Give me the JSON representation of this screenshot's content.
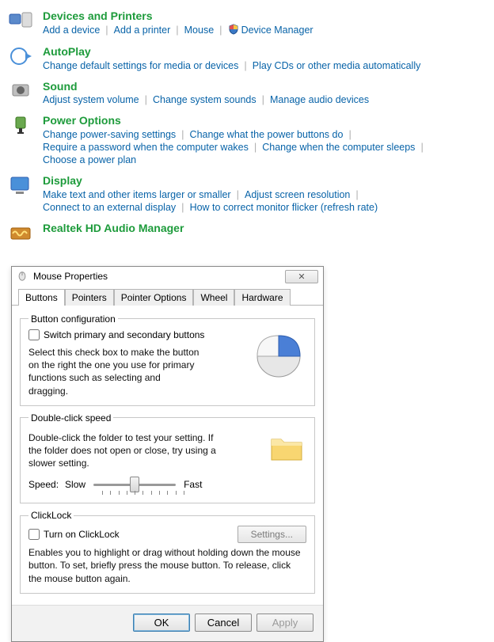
{
  "control_panel": [
    {
      "heading": "Devices and Printers",
      "links": [
        "Add a device",
        "Add a printer",
        "Mouse",
        "Device Manager"
      ],
      "shield_at": 3
    },
    {
      "heading": "AutoPlay",
      "links": [
        "Change default settings for media or devices",
        "Play CDs or other media automatically"
      ]
    },
    {
      "heading": "Sound",
      "links": [
        "Adjust system volume",
        "Change system sounds",
        "Manage audio devices"
      ]
    },
    {
      "heading": "Power Options",
      "links": [
        "Change power-saving settings",
        "Change what the power buttons do",
        "Require a password when the computer wakes",
        "Change when the computer sleeps",
        "Choose a power plan"
      ]
    },
    {
      "heading": "Display",
      "links": [
        "Make text and other items larger or smaller",
        "Adjust screen resolution",
        "Connect to an external display",
        "How to correct monitor flicker (refresh rate)"
      ]
    },
    {
      "heading": "Realtek HD Audio Manager",
      "links": []
    }
  ],
  "dialog": {
    "title": "Mouse Properties",
    "tabs": [
      "Buttons",
      "Pointers",
      "Pointer Options",
      "Wheel",
      "Hardware"
    ],
    "active_tab": 0,
    "button_config": {
      "legend": "Button configuration",
      "checkbox": "Switch primary and secondary buttons",
      "desc": "Select this check box to make the button on the right the one you use for primary functions such as selecting and dragging."
    },
    "double_click": {
      "legend": "Double-click speed",
      "desc": "Double-click the folder to test your setting. If the folder does not open or close, try using a slower setting.",
      "speed_label": "Speed:",
      "slow": "Slow",
      "fast": "Fast"
    },
    "clicklock": {
      "legend": "ClickLock",
      "checkbox": "Turn on ClickLock",
      "settings_btn": "Settings...",
      "desc": "Enables you to highlight or drag without holding down the mouse button. To set, briefly press the mouse button. To release, click the mouse button again."
    },
    "buttons": {
      "ok": "OK",
      "cancel": "Cancel",
      "apply": "Apply"
    }
  }
}
